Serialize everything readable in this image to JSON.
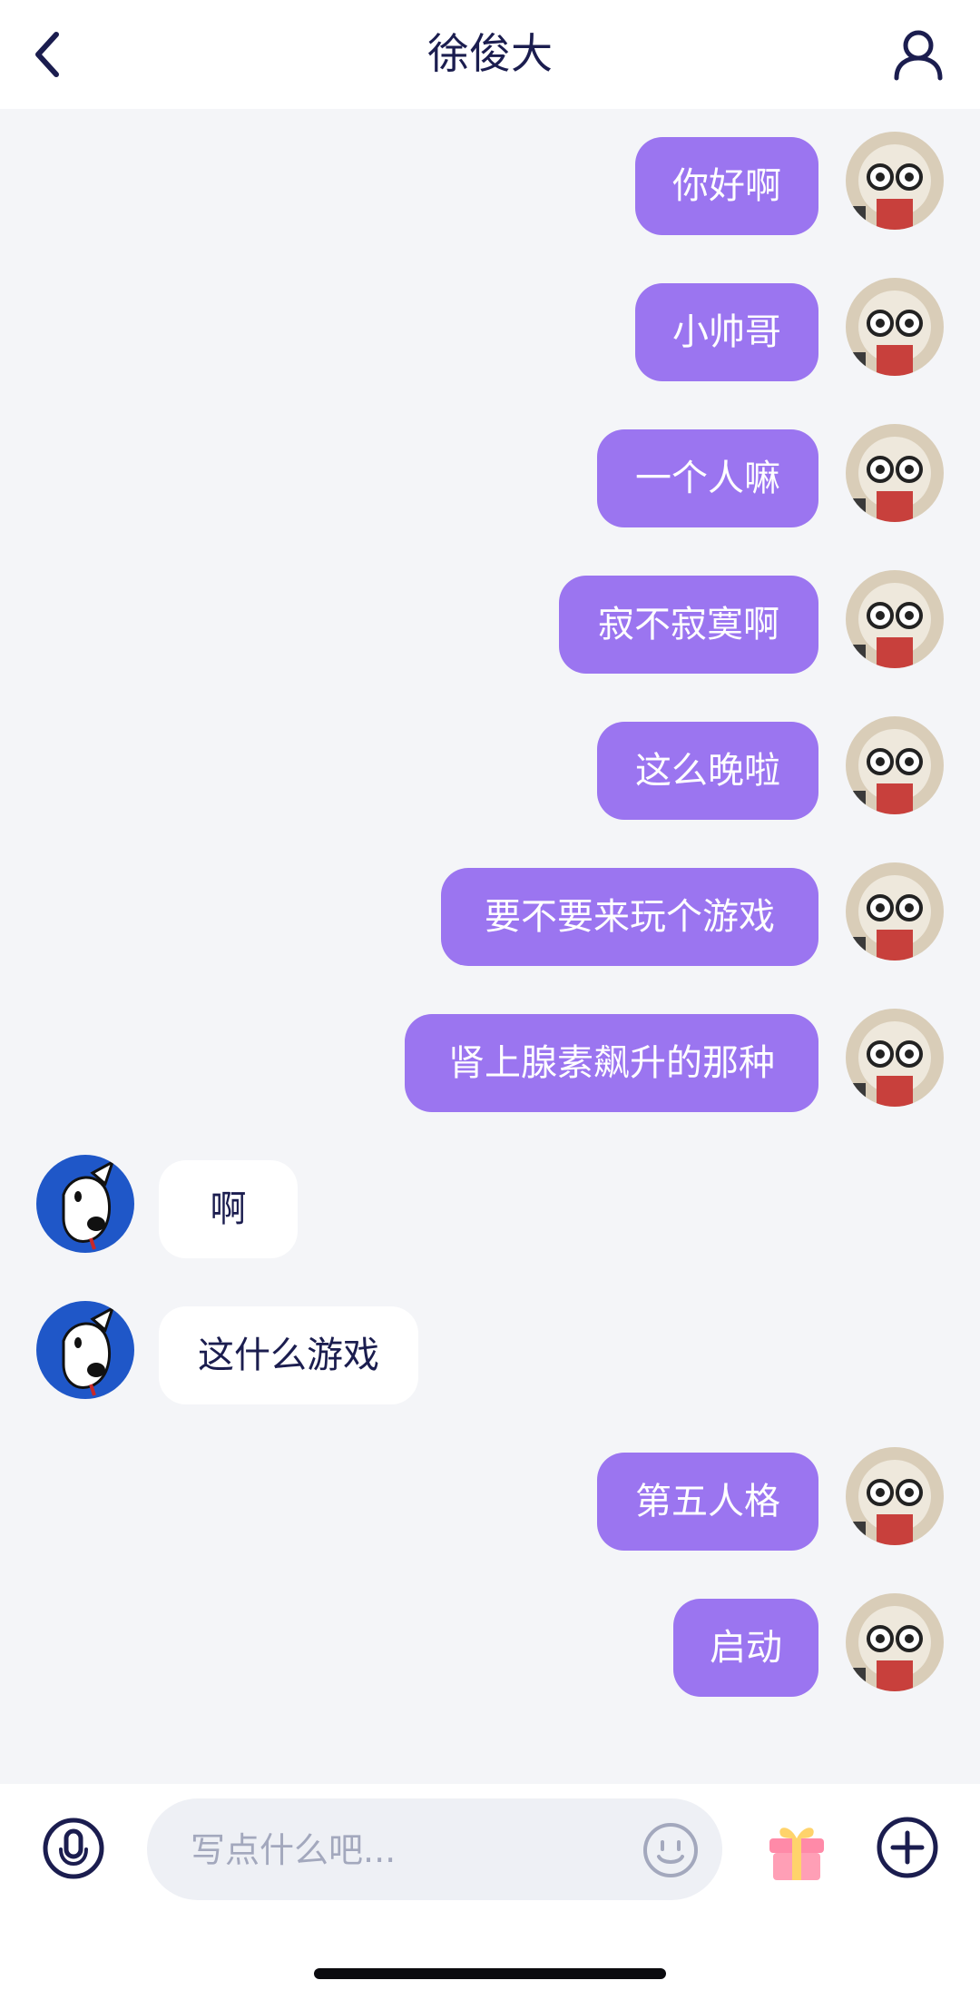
{
  "header": {
    "title": "徐俊大"
  },
  "messages": [
    {
      "side": "out",
      "text": "你好啊"
    },
    {
      "side": "out",
      "text": "小帅哥"
    },
    {
      "side": "out",
      "text": "一个人嘛"
    },
    {
      "side": "out",
      "text": "寂不寂寞啊"
    },
    {
      "side": "out",
      "text": "这么晚啦"
    },
    {
      "side": "out",
      "text": "要不要来玩个游戏"
    },
    {
      "side": "out",
      "text": "肾上腺素飙升的那种"
    },
    {
      "side": "in",
      "text": "啊"
    },
    {
      "side": "in",
      "text": "这什么游戏"
    },
    {
      "side": "out",
      "text": "第五人格"
    },
    {
      "side": "out",
      "text": "启动"
    }
  ],
  "input": {
    "placeholder": "写点什么吧...",
    "value": ""
  },
  "colors": {
    "outgoing_bubble": "#9b75f0",
    "incoming_bubble": "#ffffff",
    "title_text": "#1b1d4f",
    "background": "#f4f5f8"
  },
  "icons": {
    "back": "chevron-left-icon",
    "profile": "user-icon",
    "voice": "microphone-icon",
    "emoji": "smiley-icon",
    "gift": "gift-icon",
    "more": "plus-circle-icon"
  }
}
